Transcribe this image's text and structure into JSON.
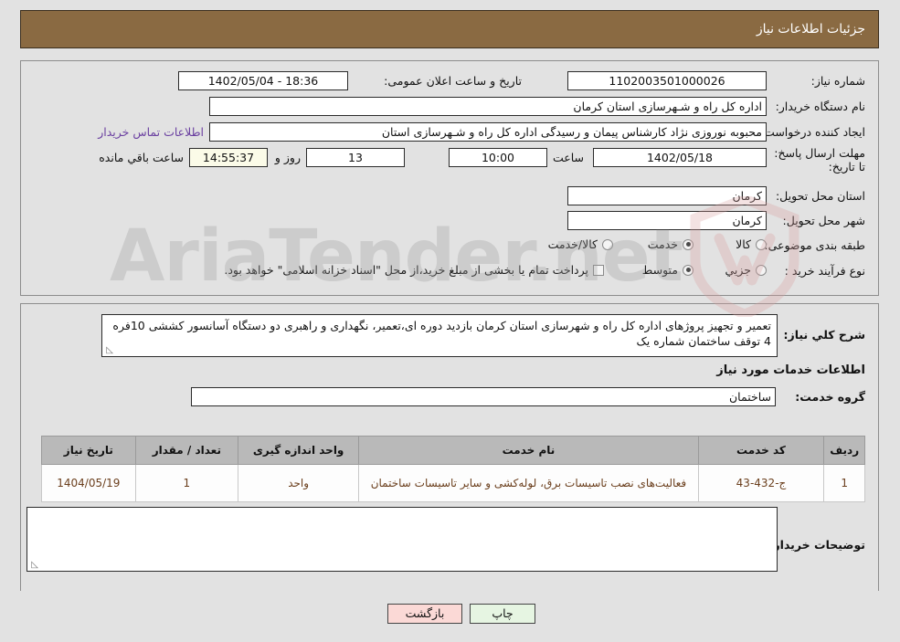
{
  "header": {
    "title": "جزئیات اطلاعات نیاز"
  },
  "form": {
    "need_number_label": "شماره نیاز:",
    "need_number_value": "1102003501000026",
    "announce_label": "تاریخ و ساعت اعلان عمومی:",
    "announce_value": "18:36 - 1402/05/04",
    "buyer_org_label": "نام دستگاه خریدار:",
    "buyer_org_value": "اداره کل راه و شـهرسازی استان کرمان",
    "creator_label": "ایجاد کننده درخواست:",
    "creator_value": "محبوبه نوروزی نژاد کارشناس پیمان و رسیدگی اداره کل راه و شـهرسازی استان",
    "contact_link": "اطلاعات تماس خریدار",
    "deadline_label": "مهلت ارسال پاسخ: تا تاریخ:",
    "deadline_date": "1402/05/18",
    "deadline_hour_label": "ساعت",
    "deadline_hour_value": "10:00",
    "days_value": "13",
    "days_unit": "روز و",
    "timer_value": "14:55:37",
    "timer_suffix": "ساعت باقي مانده",
    "province_label": "استان محل تحویل:",
    "province_value": "کرمان",
    "city_label": "شهر محل تحویل:",
    "city_value": "کرمان",
    "category_label": "طبقه بندی موضوعی:",
    "category_options": [
      "کالا",
      "خدمت",
      "کالا/خدمت"
    ],
    "category_selected": "خدمت",
    "process_label": "نوع فرآیند خرید :",
    "process_options": [
      "جزیي",
      "متوسط"
    ],
    "process_selected": "متوسط",
    "treasury_checkbox_label": "پرداخت تمام یا بخشی از مبلغ خرید،از محل \"اسناد خزانه اسلامی\" خواهد بود.",
    "treasury_checked": false
  },
  "description": {
    "label": "شرح کلي نیاز:",
    "value": "تعمیر و تجهیز پروژهای اداره کل راه و شهرسازی استان کرمان بازدید دوره ای،تعمیر، نگهداری و راهبری دو دستگاه آسانسور کششی 10فره 4 توقف ساختمان شماره یک"
  },
  "services_section": {
    "heading": "اطلاعات خدمات مورد نیاز",
    "group_label": "گروه خدمت:",
    "group_value": "ساختمان"
  },
  "table": {
    "headers": [
      "ردیف",
      "کد خدمت",
      "نام خدمت",
      "واحد اندازه گیری",
      "تعداد / مقدار",
      "تاریخ نیاز"
    ],
    "rows": [
      {
        "row": "1",
        "code": "ج-432-43",
        "name": "فعالیت‌های نصب تاسیسات برق، لوله‌کشی و سایر تاسیسات ساختمان",
        "unit": "واحد",
        "qty": "1",
        "date": "1404/05/19"
      }
    ]
  },
  "buyer_notes": {
    "label": "توضیحات خریدار:",
    "value": ""
  },
  "buttons": {
    "print": "چاپ",
    "back": "بازگشت"
  },
  "watermark": {
    "text": "AriaTender.net"
  },
  "colors": {
    "header_brown": "#8a6a42",
    "page_bg": "#e2e2e2",
    "link_purple": "#6a3fa0",
    "table_header": "#b9b9b9",
    "table_text": "#6b3f1d",
    "timer_bg": "#fbfbe8",
    "print_btn_bg": "#e6f5e2",
    "back_btn_bg": "#fbd9d6"
  }
}
